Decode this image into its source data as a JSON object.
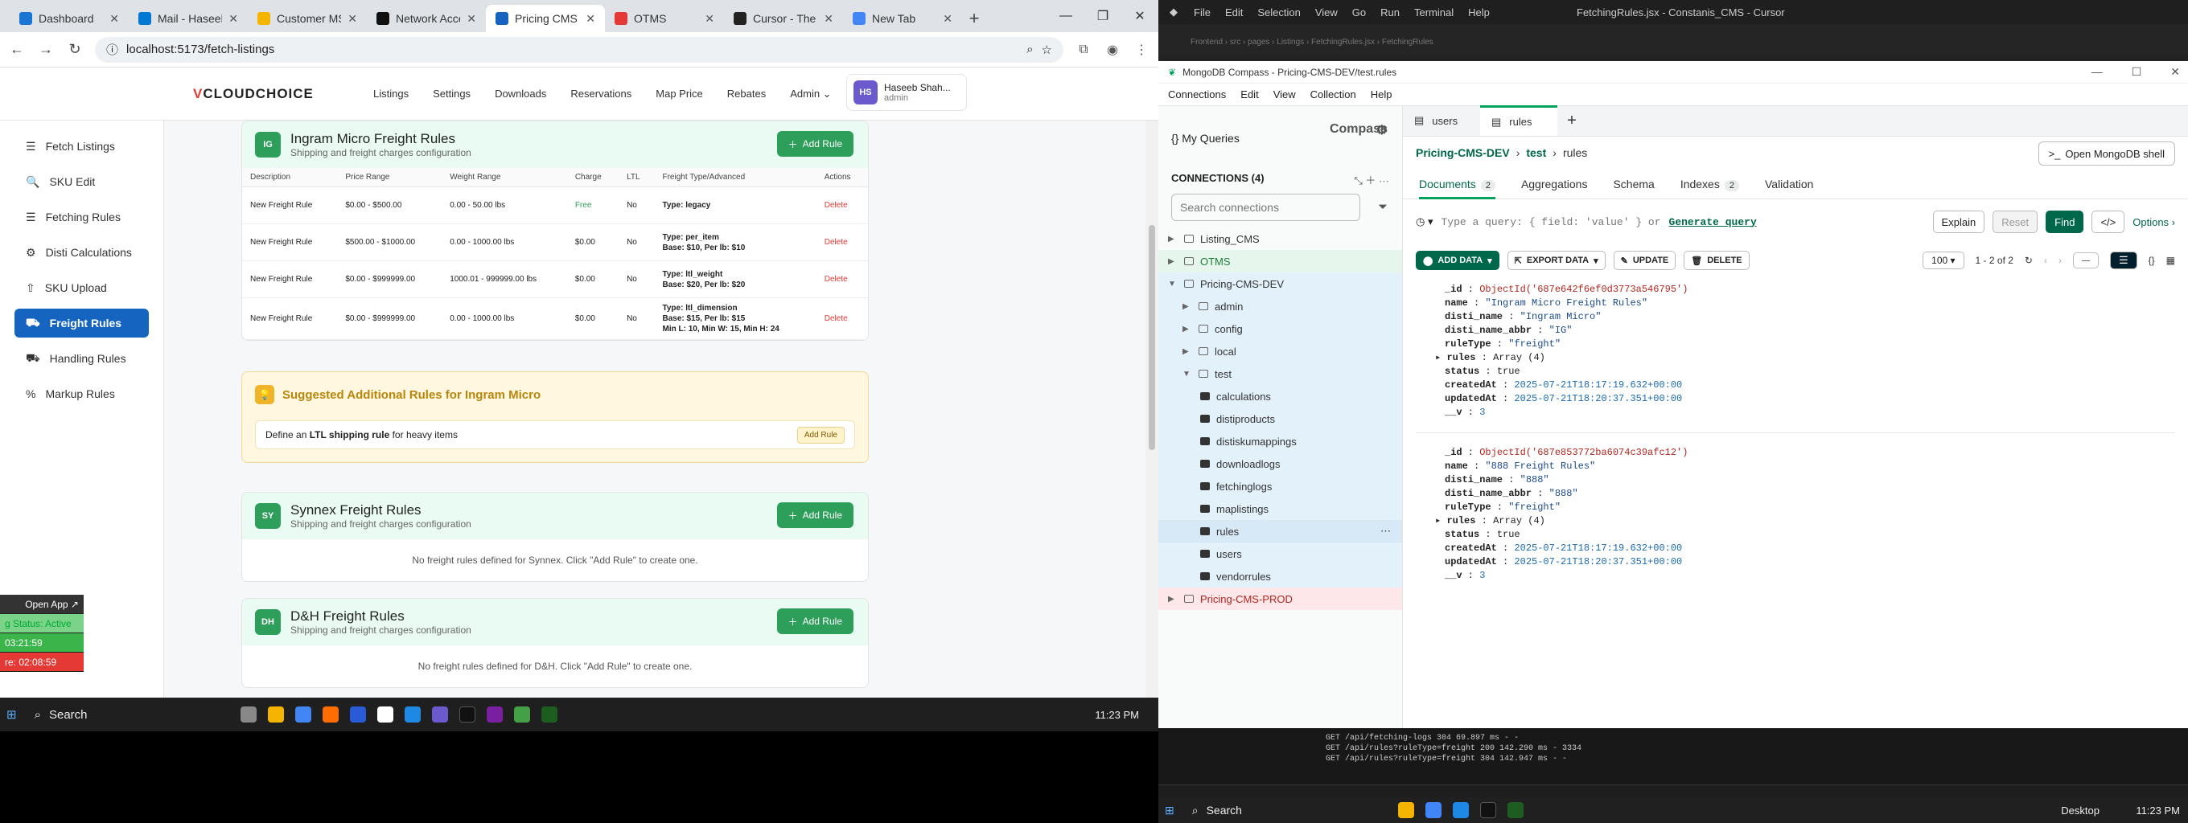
{
  "browser": {
    "tabs": [
      {
        "title": "Dashboard",
        "color": "#1976d2"
      },
      {
        "title": "Mail - Haseeb",
        "color": "#0078d4"
      },
      {
        "title": "Customer MS",
        "color": "#f4b400"
      },
      {
        "title": "Network Access",
        "color": "#111111"
      },
      {
        "title": "Pricing CMS",
        "color": "#1565c0",
        "active": true
      },
      {
        "title": "OTMS",
        "color": "#e53935"
      },
      {
        "title": "Cursor - The AI",
        "color": "#222222"
      },
      {
        "title": "New Tab",
        "color": "#4285f4"
      }
    ],
    "url": "localhost:5173/fetch-listings"
  },
  "app": {
    "logo_prefix": "V",
    "logo_rest": "CLOUDCHOICE",
    "menu": [
      "Listings",
      "Settings",
      "Downloads",
      "Reservations",
      "Map Price",
      "Rebates",
      "Admin ⌄"
    ],
    "user": {
      "initials": "HS",
      "name": "Haseeb Shah...",
      "role": "admin"
    },
    "sidebar": [
      {
        "label": "Fetch Listings",
        "icon": "☰"
      },
      {
        "label": "SKU Edit",
        "icon": "🔍"
      },
      {
        "label": "Fetching Rules",
        "icon": "☰"
      },
      {
        "label": "Disti Calculations",
        "icon": "⚙"
      },
      {
        "label": "SKU Upload",
        "icon": "⇧"
      },
      {
        "label": "Freight Rules",
        "icon": "⛟",
        "active": true
      },
      {
        "label": "Handling Rules",
        "icon": "⛟"
      },
      {
        "label": "Markup Rules",
        "icon": "%"
      }
    ]
  },
  "ingram": {
    "badge": "IG",
    "title": "Ingram Micro Freight Rules",
    "subtitle": "Shipping and freight charges configuration",
    "add_label": "Add Rule",
    "columns": [
      "Description",
      "Price Range",
      "Weight Range",
      "Charge",
      "LTL",
      "Freight Type/Advanced",
      "Actions"
    ],
    "rows": [
      {
        "desc": "New Freight Rule",
        "price": "$0.00 - $500.00",
        "weight": "0.00 - 50.00 lbs",
        "charge": "Free",
        "ltl": "No",
        "adv": [
          "Type: legacy"
        ],
        "action": "Delete"
      },
      {
        "desc": "New Freight Rule",
        "price": "$500.00 - $1000.00",
        "weight": "0.00 - 1000.00 lbs",
        "charge": "$0.00",
        "ltl": "No",
        "adv": [
          "Type: per_item",
          "Base: $10, Per lb: $10"
        ],
        "action": "Delete"
      },
      {
        "desc": "New Freight Rule",
        "price": "$0.00 - $999999.00",
        "weight": "1000.01 - 999999.00 lbs",
        "charge": "$0.00",
        "ltl": "No",
        "adv": [
          "Type: ltl_weight",
          "Base: $20, Per lb: $20"
        ],
        "action": "Delete"
      },
      {
        "desc": "New Freight Rule",
        "price": "$0.00 - $999999.00",
        "weight": "0.00 - 1000.00 lbs",
        "charge": "$0.00",
        "ltl": "No",
        "adv": [
          "Type: ltl_dimension",
          "Base: $15, Per lb: $15",
          "Min L: 10, Min W: 15, Min H: 24"
        ],
        "action": "Delete"
      }
    ]
  },
  "suggestion": {
    "title": "Suggested Additional Rules for Ingram Micro",
    "text_pre": "Define an ",
    "text_bold": "LTL shipping rule",
    "text_post": " for heavy items",
    "button": "Add Rule"
  },
  "synnex": {
    "badge": "SY",
    "title": "Synnex Freight Rules",
    "subtitle": "Shipping and freight charges configuration",
    "add_label": "Add Rule",
    "empty": "No freight rules defined for Synnex. Click \"Add Rule\" to create one."
  },
  "dh": {
    "badge": "DH",
    "title": "D&H Freight Rules",
    "subtitle": "Shipping and freight charges configuration",
    "add_label": "Add Rule",
    "empty": "No freight rules defined for D&H. Click \"Add Rule\" to create one."
  },
  "widget": {
    "open": "Open App ↗",
    "status": "g Status: Active",
    "t1": "03:21:59",
    "t2": "re: 02:08:59"
  },
  "taskbar": {
    "search": "Search",
    "time": "11:23 PM"
  },
  "cursor": {
    "menu": [
      "File",
      "Edit",
      "Selection",
      "View",
      "Go",
      "Run",
      "Terminal",
      "Help"
    ],
    "title": "FetchingRules.jsx - Constanis_CMS - Cursor",
    "breadcrumb": "Frontend › src › pages › Listings › FetchingRules.jsx › FetchingRules"
  },
  "compass": {
    "window_title": "MongoDB Compass - Pricing-CMS-DEV/test.rules",
    "menu": [
      "Connections",
      "Edit",
      "View",
      "Collection",
      "Help"
    ],
    "brand": "Compass",
    "my_queries": "My Queries",
    "connections_label": "CONNECTIONS (4)",
    "search_placeholder": "Search connections",
    "tree": [
      {
        "label": "Listing_CMS",
        "depth": 0,
        "kind": "conn"
      },
      {
        "label": "OTMS",
        "depth": 0,
        "kind": "otms"
      },
      {
        "label": "Pricing-CMS-DEV",
        "depth": 0,
        "kind": "open"
      },
      {
        "label": "admin",
        "depth": 1,
        "kind": "db"
      },
      {
        "label": "config",
        "depth": 1,
        "kind": "db"
      },
      {
        "label": "local",
        "depth": 1,
        "kind": "db"
      },
      {
        "label": "test",
        "depth": 1,
        "kind": "dbopen"
      },
      {
        "label": "calculations",
        "depth": 2,
        "kind": "col"
      },
      {
        "label": "distiproducts",
        "depth": 2,
        "kind": "col"
      },
      {
        "label": "distiskumappings",
        "depth": 2,
        "kind": "col"
      },
      {
        "label": "downloadlogs",
        "depth": 2,
        "kind": "col"
      },
      {
        "label": "fetchinglogs",
        "depth": 2,
        "kind": "col"
      },
      {
        "label": "maplistings",
        "depth": 2,
        "kind": "col"
      },
      {
        "label": "rules",
        "depth": 2,
        "kind": "colsel"
      },
      {
        "label": "users",
        "depth": 2,
        "kind": "col"
      },
      {
        "label": "vendorrules",
        "depth": 2,
        "kind": "col"
      },
      {
        "label": "Pricing-CMS-PROD",
        "depth": 0,
        "kind": "prod"
      }
    ],
    "tabs": [
      "users",
      "rules"
    ],
    "bread_conn": "Pricing-CMS-DEV",
    "bread_db": "test",
    "bread_col": "rules",
    "shell_button": "Open MongoDB shell",
    "subtabs": [
      {
        "label": "Documents",
        "count": "2"
      },
      {
        "label": "Aggregations",
        "count": ""
      },
      {
        "label": "Schema",
        "count": ""
      },
      {
        "label": "Indexes",
        "count": "2"
      },
      {
        "label": "Validation",
        "count": ""
      }
    ],
    "query_text": "Type a query: { field: 'value' } or ",
    "query_link": "Generate query",
    "explain": "Explain",
    "reset": "Reset",
    "find": "Find",
    "options": "Options ›",
    "add_data": "ADD DATA",
    "export_data": "EXPORT DATA",
    "update": "UPDATE",
    "delete": "DELETE",
    "page_size": "100",
    "range": "1 - 2 of 2",
    "docs": [
      {
        "id": "ObjectId('687e642f6ef0d3773a546795')",
        "name": "\"Ingram Micro Freight Rules\"",
        "disti_name": "\"Ingram Micro\"",
        "abbr": "\"IG\"",
        "ruleType": "\"freight\"",
        "rules": "Array (4)",
        "status": "true",
        "createdAt": "2025-07-21T18:17:19.632+00:00",
        "updatedAt": "2025-07-21T18:20:37.351+00:00",
        "v": "3"
      },
      {
        "id": "ObjectId('687e853772ba6074c39afc12')",
        "name": "\"888 Freight Rules\"",
        "disti_name": "\"888\"",
        "abbr": "\"888\"",
        "ruleType": "\"freight\"",
        "rules": "Array (4)",
        "status": "true",
        "createdAt": "2025-07-21T18:17:19.632+00:00",
        "updatedAt": "2025-07-21T18:20:37.351+00:00",
        "v": "3"
      }
    ]
  },
  "terminal": [
    "GET /api/fetching-logs 304 69.897 ms - -",
    "GET /api/rules?ruleType=freight 200 142.290 ms - 3334",
    "GET /api/rules?ruleType=freight 304 142.947 ms - -"
  ],
  "taskbar2": {
    "search": "Search",
    "desktop": "Desktop",
    "time": "11:23 PM"
  }
}
